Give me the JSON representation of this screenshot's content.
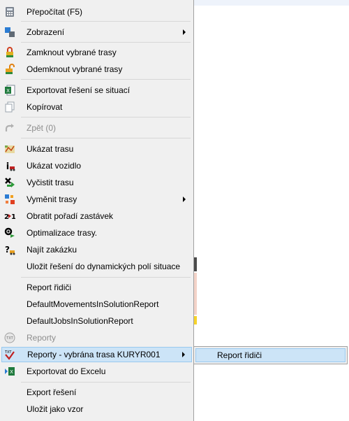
{
  "menu": {
    "items": [
      {
        "label": "Přepočítat (F5)",
        "icon": "calculator-icon"
      },
      {
        "label": "Zobrazení",
        "icon": "view-icon",
        "submenu": true
      },
      {
        "label": "Zamknout vybrané trasy",
        "icon": "lock-icon"
      },
      {
        "label": "Odemknout vybrané trasy",
        "icon": "unlock-icon"
      },
      {
        "label": "Exportovat řešení se situací",
        "icon": "excel-export-icon"
      },
      {
        "label": "Kopírovat",
        "icon": "copy-icon"
      },
      {
        "label": "Zpět (0)",
        "icon": "redo-icon",
        "disabled": true
      },
      {
        "label": "Ukázat trasu",
        "icon": "route-map-icon"
      },
      {
        "label": "Ukázat vozidlo",
        "icon": "vehicle-info-icon"
      },
      {
        "label": "Vyčistit trasu",
        "icon": "clear-route-icon"
      },
      {
        "label": "Vyměnit trasy",
        "icon": "swap-routes-icon",
        "submenu": true
      },
      {
        "label": "Obratit pořadí zastávek",
        "icon": "reverse-order-icon"
      },
      {
        "label": "Optimalizace trasy.",
        "icon": "optimize-icon"
      },
      {
        "label": "Najít zakázku",
        "icon": "find-job-icon"
      },
      {
        "label": "Uložit řešení do dynamických polí situace",
        "icon": ""
      },
      {
        "label": "Report řidiči",
        "icon": ""
      },
      {
        "label": "DefaultMovementsInSolutionReport",
        "icon": ""
      },
      {
        "label": "DefaultJobsInSolutionReport",
        "icon": ""
      },
      {
        "label": "Reporty",
        "icon": "txt-icon",
        "disabled": true
      },
      {
        "label": "Reporty - vybrána trasa KURYR001",
        "icon": "txt-report-icon",
        "submenu": true,
        "highlighted": true
      },
      {
        "label": "Exportovat do Excelu",
        "icon": "excel-icon"
      },
      {
        "label": "Export řešení",
        "icon": ""
      },
      {
        "label": "Uložit jako vzor",
        "icon": ""
      }
    ]
  },
  "submenu": {
    "items": [
      {
        "label": "Report řidiči"
      }
    ]
  },
  "colors": {
    "menu_bg": "#f0f0f0",
    "highlight": "#cce4f7",
    "highlight_border": "#99c9ef",
    "disabled_text": "#8d8d8d"
  }
}
